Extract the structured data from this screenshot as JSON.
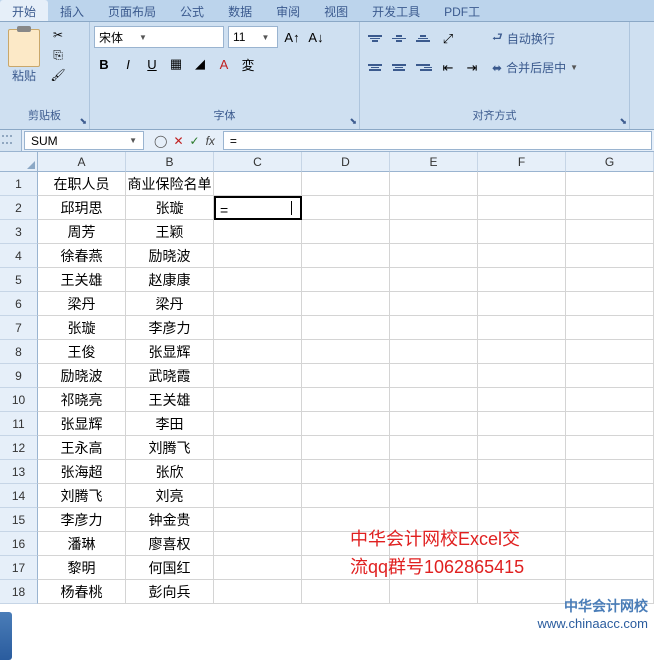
{
  "tabs": [
    "开始",
    "插入",
    "页面布局",
    "公式",
    "数据",
    "审阅",
    "视图",
    "开发工具",
    "PDF工"
  ],
  "active_tab": 0,
  "ribbon": {
    "clipboard": {
      "label": "剪贴板",
      "paste": "粘贴"
    },
    "font": {
      "label": "字体",
      "name": "宋体",
      "size": "11",
      "bold": "B",
      "italic": "I",
      "underline": "U"
    },
    "align": {
      "label": "对齐方式",
      "wrap": "自动换行",
      "merge": "合并后居中"
    }
  },
  "namebox": "SUM",
  "formula": "=",
  "columns": [
    "A",
    "B",
    "C",
    "D",
    "E",
    "F",
    "G"
  ],
  "rows": [
    {
      "n": "1",
      "A": "在职人员",
      "B": "商业保险名单",
      "C": ""
    },
    {
      "n": "2",
      "A": "邱玥思",
      "B": "张璇",
      "C": "="
    },
    {
      "n": "3",
      "A": "周芳",
      "B": "王颖",
      "C": ""
    },
    {
      "n": "4",
      "A": "徐春燕",
      "B": "励晓波",
      "C": ""
    },
    {
      "n": "5",
      "A": "王关雄",
      "B": "赵康康",
      "C": ""
    },
    {
      "n": "6",
      "A": "梁丹",
      "B": "梁丹",
      "C": ""
    },
    {
      "n": "7",
      "A": "张璇",
      "B": "李彦力",
      "C": ""
    },
    {
      "n": "8",
      "A": "王俊",
      "B": "张显辉",
      "C": ""
    },
    {
      "n": "9",
      "A": "励晓波",
      "B": "武晓霞",
      "C": ""
    },
    {
      "n": "10",
      "A": "祁晓亮",
      "B": "王关雄",
      "C": ""
    },
    {
      "n": "11",
      "A": "张显辉",
      "B": "李田",
      "C": ""
    },
    {
      "n": "12",
      "A": "王永高",
      "B": "刘腾飞",
      "C": ""
    },
    {
      "n": "13",
      "A": "张海超",
      "B": "张欣",
      "C": ""
    },
    {
      "n": "14",
      "A": "刘腾飞",
      "B": "刘亮",
      "C": ""
    },
    {
      "n": "15",
      "A": "李彦力",
      "B": "钟金贵",
      "C": ""
    },
    {
      "n": "16",
      "A": "潘琳",
      "B": "廖喜权",
      "C": ""
    },
    {
      "n": "17",
      "A": "黎明",
      "B": "何国红",
      "C": ""
    },
    {
      "n": "18",
      "A": "杨春桃",
      "B": "彭向兵",
      "C": ""
    }
  ],
  "overlay": {
    "line1": "中华会计网校Excel交",
    "line2": "流qq群号1062865415"
  },
  "watermark": {
    "line1": "中华会计网校",
    "line2": "www.chinaacc.com"
  },
  "chart_data": {
    "type": "table",
    "columns": [
      "在职人员",
      "商业保险名单"
    ],
    "data": [
      [
        "邱玥思",
        "张璇"
      ],
      [
        "周芳",
        "王颖"
      ],
      [
        "徐春燕",
        "励晓波"
      ],
      [
        "王关雄",
        "赵康康"
      ],
      [
        "梁丹",
        "梁丹"
      ],
      [
        "张璇",
        "李彦力"
      ],
      [
        "王俊",
        "张显辉"
      ],
      [
        "励晓波",
        "武晓霞"
      ],
      [
        "祁晓亮",
        "王关雄"
      ],
      [
        "张显辉",
        "李田"
      ],
      [
        "王永高",
        "刘腾飞"
      ],
      [
        "张海超",
        "张欣"
      ],
      [
        "刘腾飞",
        "刘亮"
      ],
      [
        "李彦力",
        "钟金贵"
      ],
      [
        "潘琳",
        "廖喜权"
      ],
      [
        "黎明",
        "何国红"
      ],
      [
        "杨春桃",
        "彭向兵"
      ]
    ]
  }
}
